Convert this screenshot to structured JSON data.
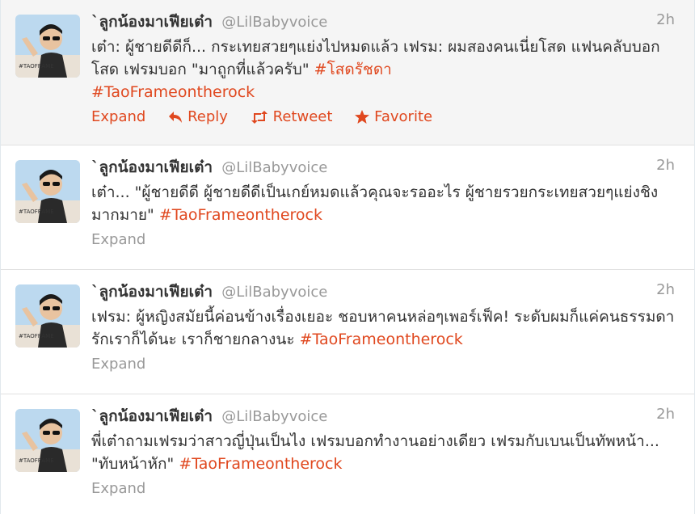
{
  "tweets": [
    {
      "fullname": "`ลูกน้องมาเฟียเต๋า",
      "username": "@LilBabyvoice",
      "time": "2h",
      "text": "เต๋า: ผู้ชายดีดีก็... กระเทยสวยๆแย่งไปหมดแล้ว เฟรม: ผมสองคนเนี่ยโสด แฟนคลับบอกโสด เฟรมบอก \"มาถูกที่แล้วครับ\" ",
      "hashtags": [
        "#โสดรัชดา",
        "#TaoFrameontherock"
      ],
      "actions": {
        "expand": "Expand",
        "reply": "Reply",
        "retweet": "Retweet",
        "favorite": "Favorite"
      }
    },
    {
      "fullname": "`ลูกน้องมาเฟียเต๋า",
      "username": "@LilBabyvoice",
      "time": "2h",
      "text": "เต๋า... \"ผู้ชายดีดี ผู้ชายดีดีเป็นเกย์หมดแล้วคุณจะรออะไร ผู้ชายรวยกระเทยสวยๆแย่งชิงมากมาย\" ",
      "hashtags": [
        "#TaoFrameontherock"
      ],
      "actions": {
        "expand": "Expand"
      }
    },
    {
      "fullname": "`ลูกน้องมาเฟียเต๋า",
      "username": "@LilBabyvoice",
      "time": "2h",
      "text": "เฟรม: ผู้หญิงสมัยนี้ค่อนข้างเรื่องเยอะ ชอบหาคนหล่อๆเพอร์เฟ็ค! ระดับผมก็แค่คนธรรมดา รักเราก็ได้นะ เราก็ชายกลางนะ ",
      "hashtags": [
        "#TaoFrameontherock"
      ],
      "actions": {
        "expand": "Expand"
      }
    },
    {
      "fullname": "`ลูกน้องมาเฟียเต๋า",
      "username": "@LilBabyvoice",
      "time": "2h",
      "text": "พี่เต๋าถามเฟรมว่าสาวญี่ปุ่นเป็นไง เฟรมบอกทำงานอย่างเดียว เฟรมกับเบนเป็นทัพหน้า... \"ทับหน้าหัก\" ",
      "hashtags": [
        "#TaoFrameontherock"
      ],
      "actions": {
        "expand": "Expand"
      }
    }
  ],
  "colors": {
    "accent": "#e0481f",
    "muted": "#999999",
    "active_bg": "#f5f5f5"
  },
  "icons": {
    "reply": "reply-arrow-icon",
    "retweet": "retweet-icon",
    "favorite": "star-icon"
  }
}
